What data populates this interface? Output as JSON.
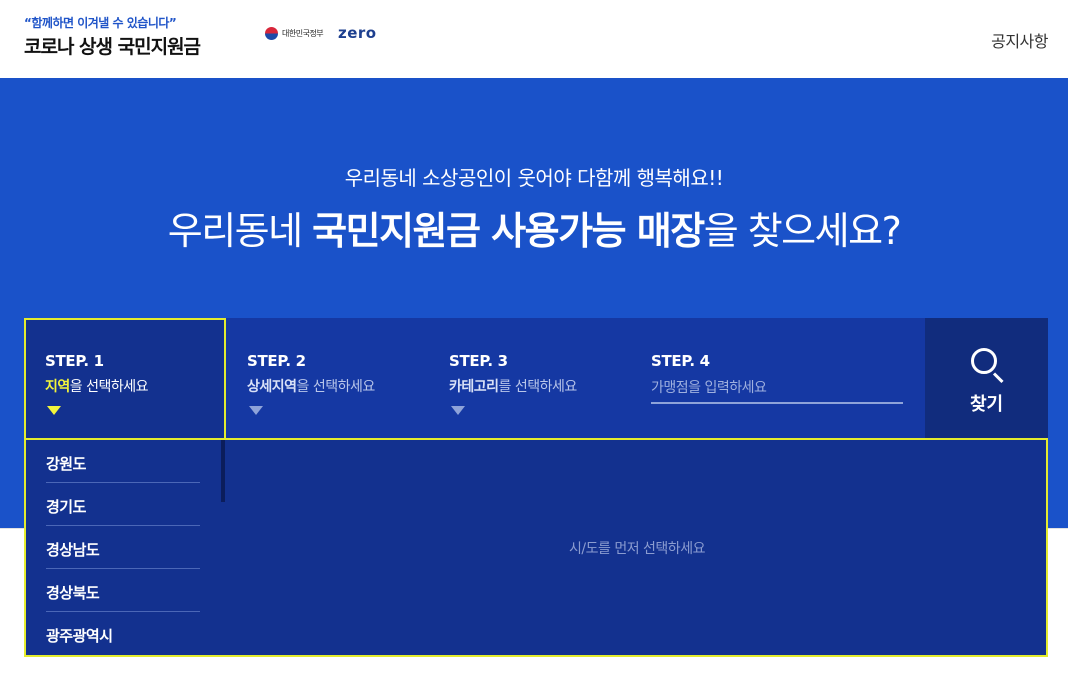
{
  "header": {
    "slogan": "“함께하면 이겨낼 수 있습니다”",
    "brand": "코로나 상생 국민지원금",
    "gov_label": "대한민국정부",
    "zero_label": "zero",
    "notice_link": "공지사항"
  },
  "hero": {
    "subtitle": "우리동네 소상공인이 웃어야 다함께 행복해요!!",
    "title_pre": "우리동네 ",
    "title_bold": "국민지원금 사용가능 매장",
    "title_post": "을 찾으세요?"
  },
  "steps": [
    {
      "num": "STEP. 1",
      "highlight": "지역",
      "rest": "을 선택하세요"
    },
    {
      "num": "STEP. 2",
      "highlight": "상세지역",
      "rest": "을 선택하세요"
    },
    {
      "num": "STEP. 3",
      "highlight": "카테고리",
      "rest": "를 선택하세요"
    },
    {
      "num": "STEP. 4",
      "placeholder": "가맹점을 입력하세요"
    }
  ],
  "search_button": {
    "label": "찾기",
    "icon": "search-icon"
  },
  "regions": [
    "강원도",
    "경기도",
    "경상남도",
    "경상북도",
    "광주광역시"
  ],
  "panel_message": "시/도를 먼저 선택하세요",
  "colors": {
    "hero_blue": "#1a52c9",
    "steps_navy": "#1538a3",
    "highlight_yellow": "#f2f53b"
  }
}
